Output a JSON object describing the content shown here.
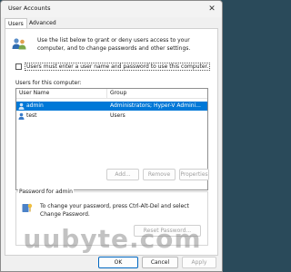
{
  "window": {
    "title": "User Accounts",
    "close_glyph": "✕"
  },
  "tabs": [
    {
      "label": "Users",
      "active": true
    },
    {
      "label": "Advanced",
      "active": false
    }
  ],
  "intro": {
    "icon": "users-icon",
    "text": "Use the list below to grant or deny users access to your computer, and to change passwords and other settings."
  },
  "require_login": {
    "label": "Users must enter a user name and password to use this computer.",
    "checked": false
  },
  "users_list": {
    "label": "Users for this computer:",
    "columns": [
      "User Name",
      "Group"
    ],
    "rows": [
      {
        "user": "admin",
        "group": "Administrators; Hyper-V Admini...",
        "selected": true,
        "icon": "user-icon"
      },
      {
        "user": "test",
        "group": "Users",
        "selected": false,
        "icon": "user-icon"
      }
    ]
  },
  "list_buttons": {
    "add": "Add...",
    "remove": "Remove",
    "properties": "Properties"
  },
  "password_group": {
    "title": "Password for admin",
    "icon": "key-icon",
    "text": "To change your password, press Ctrl-Alt-Del and select Change Password.",
    "reset_button": "Reset Password..."
  },
  "footer_buttons": {
    "ok": "OK",
    "cancel": "Cancel",
    "apply": "Apply"
  },
  "watermark": "uubyte.com",
  "colors": {
    "selection": "#0078d7",
    "accent": "#0067c0"
  }
}
